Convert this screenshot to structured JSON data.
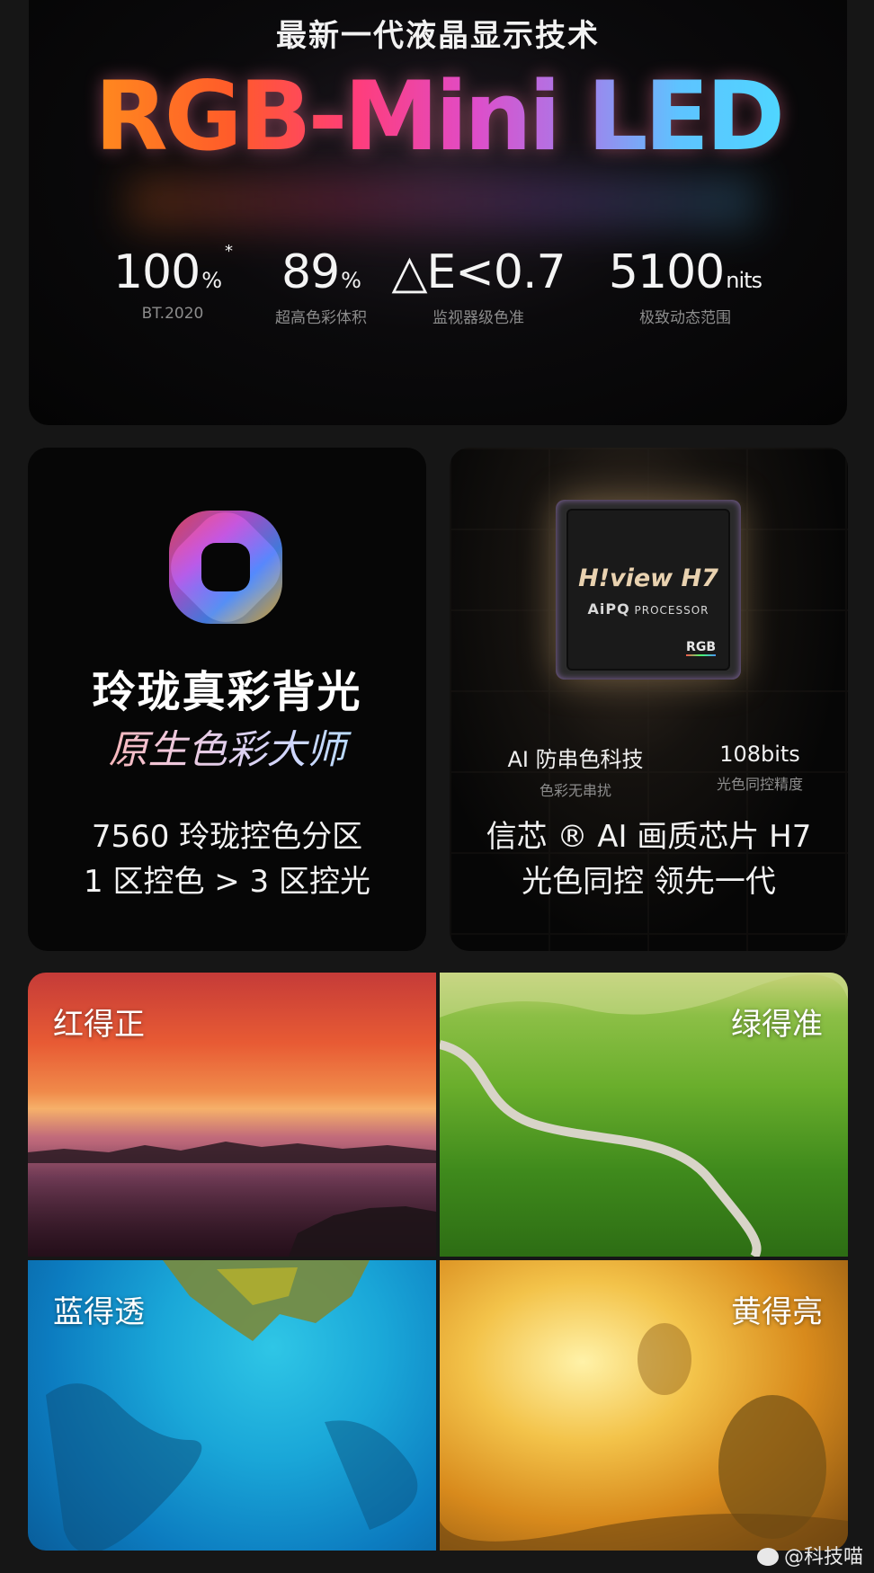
{
  "hero": {
    "subtitle": "最新一代液晶显示技术",
    "title": "RGB-Mini LED",
    "stats": [
      {
        "value": "100",
        "unit": "%",
        "asterisk": "*",
        "label": "BT.2020"
      },
      {
        "value": "89",
        "unit": "%",
        "label": "超高色彩体积"
      },
      {
        "value": "△E<0.7",
        "unit": "",
        "label": "监视器级色准"
      },
      {
        "value": "5100",
        "unit": "nits",
        "label": "极致动态范围"
      }
    ]
  },
  "left_card": {
    "icon": "colorful-rounded-square-logo-icon",
    "title": "玲珑真彩背光",
    "script": "原生色彩大师",
    "line1": "7560 玲珑控色分区",
    "line2": "1 区控色 > 3 区控光"
  },
  "right_card": {
    "chip_brand": "H!view H7",
    "chip_processor_prefix": "AiPQ",
    "chip_processor": "PROCESSOR",
    "chip_badge": "RGB",
    "feature1_title": "AI 防串色科技",
    "feature1_sub": "色彩无串扰",
    "feature2_title": "108bits",
    "feature2_sub": "光色同控精度",
    "line1": "信芯 ® AI 画质芯片 H7",
    "line2": "光色同控 领先一代"
  },
  "photos": {
    "red": "红得正",
    "green": "绿得准",
    "blue": "蓝得透",
    "yellow": "黄得亮"
  },
  "watermark": "@科技喵",
  "colors": {
    "background": "#161616",
    "card": "#050505",
    "muted_text": "#8c8c8c"
  }
}
